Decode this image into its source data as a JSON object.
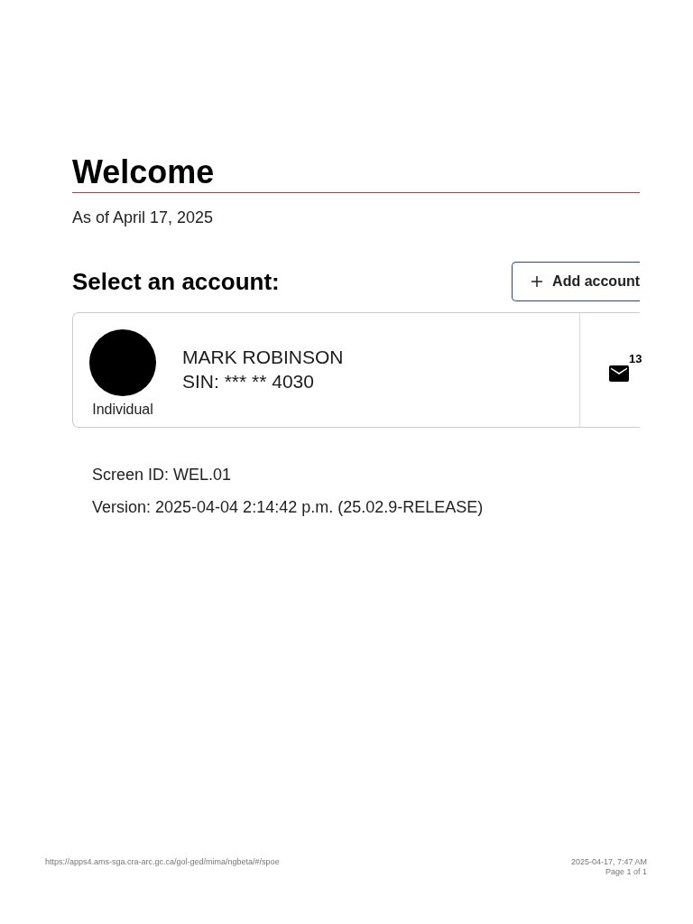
{
  "page": {
    "title": "Welcome",
    "as_of": "As of April 17, 2025"
  },
  "accounts_section": {
    "heading": "Select an account:",
    "add_button": {
      "label": "Add account"
    },
    "accounts": [
      {
        "type": "Individual",
        "name": "MARK ROBINSON",
        "sin": "SIN: *** ** 4030",
        "unread_messages": "13"
      }
    ]
  },
  "screen_info": {
    "screen_id": "Screen ID: WEL.01",
    "version": "Version: 2025-04-04 2:14:42 p.m. (25.02.9-RELEASE)"
  },
  "print_footer": {
    "url": "https://apps4.ams-sga.cra-arc.gc.ca/gol-ged/mima/ngbeta/#/spoe",
    "timestamp": "2025-04-17, 7:47 AM",
    "page": "Page 1 of 1"
  }
}
